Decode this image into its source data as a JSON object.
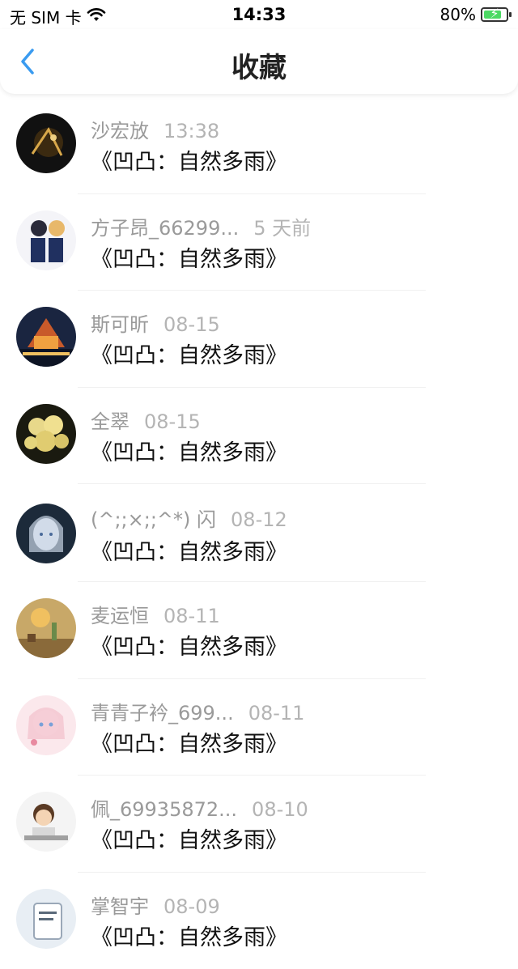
{
  "status": {
    "carrier": "无 SIM 卡",
    "time": "14:33",
    "battery": "80%",
    "battery_level": 0.8,
    "icons": [
      "wifi-icon",
      "battery-charging-icon"
    ]
  },
  "nav": {
    "title": "收藏",
    "back_icon": "chevron-left-icon",
    "accent": "#3a9bf0"
  },
  "items": [
    {
      "name": "沙宏放",
      "time": "13:38",
      "content": "《凹凸：自然多雨》"
    },
    {
      "name": "方子昂_66299...",
      "time": "5 天前",
      "content": "《凹凸：自然多雨》"
    },
    {
      "name": "斯可昕",
      "time": "08-15",
      "content": "《凹凸：自然多雨》"
    },
    {
      "name": "全翠",
      "time": "08-15",
      "content": "《凹凸：自然多雨》"
    },
    {
      "name": "(^;;×;;^*) 闪",
      "time": "08-12",
      "content": "《凹凸：自然多雨》"
    },
    {
      "name": "麦运恒",
      "time": "08-11",
      "content": "《凹凸：自然多雨》"
    },
    {
      "name": "青青子衿_699...",
      "time": "08-11",
      "content": "《凹凸：自然多雨》"
    },
    {
      "name": "佩_69935872...",
      "time": "08-10",
      "content": "《凹凸：自然多雨》"
    },
    {
      "name": "掌智宇",
      "time": "08-09",
      "content": "《凹凸：自然多雨》"
    }
  ]
}
